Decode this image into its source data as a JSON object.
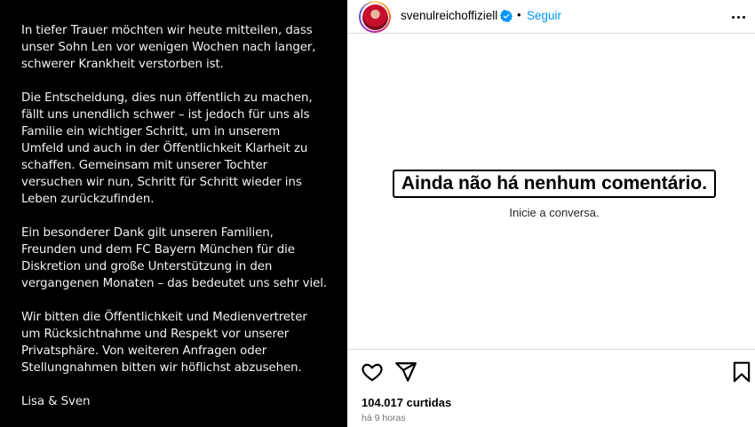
{
  "post_text": {
    "paragraphs": [
      "In tiefer Trauer möchten wir heute mitteilen, dass\nunser Sohn Len vor wenigen Wochen nach langer,\nschwerer Krankheit verstorben ist.",
      "Die Entscheidung, dies nun öffentlich zu machen,\nfällt uns unendlich schwer – ist jedoch für uns als\nFamilie ein wichtiger Schritt, um in unserem\nUmfeld und auch in der Öffentlichkeit Klarheit zu\nschaffen. Gemeinsam mit unserer Tochter\nversuchen wir nun, Schritt für Schritt wieder ins\nLeben zurückzufinden.",
      "Ein besonderer Dank gilt unseren Familien,\nFreunden und dem FC Bayern München für die\nDiskretion und große Unterstützung in den\nvergangenen Monaten – das bedeutet uns sehr viel.",
      "Wir bitten die Öffentlichkeit und Medienvertreter\num Rücksichtnahme und Respekt vor unserer\nPrivatsphäre. Von weiteren Anfragen oder\nStellungnahmen bitten wir höflichst abzusehen.",
      "Lisa & Sven"
    ]
  },
  "header": {
    "username": "svenulreichoffiziell",
    "separator": "•",
    "follow_label": "Seguir",
    "verified_icon": "verified-badge-icon",
    "more_icon": "more-options-icon"
  },
  "comments": {
    "empty_title": "Ainda não há nenhum comentário.",
    "empty_subtitle": "Inicie a conversa."
  },
  "actions": {
    "like_icon": "heart-icon",
    "share_icon": "share-icon",
    "save_icon": "bookmark-icon",
    "likes_text": "104.017 curtidas",
    "time_text": "há 9 horas"
  },
  "colors": {
    "accent": "#0095f6",
    "image_bg": "#000000",
    "verified": "#0095f6"
  }
}
